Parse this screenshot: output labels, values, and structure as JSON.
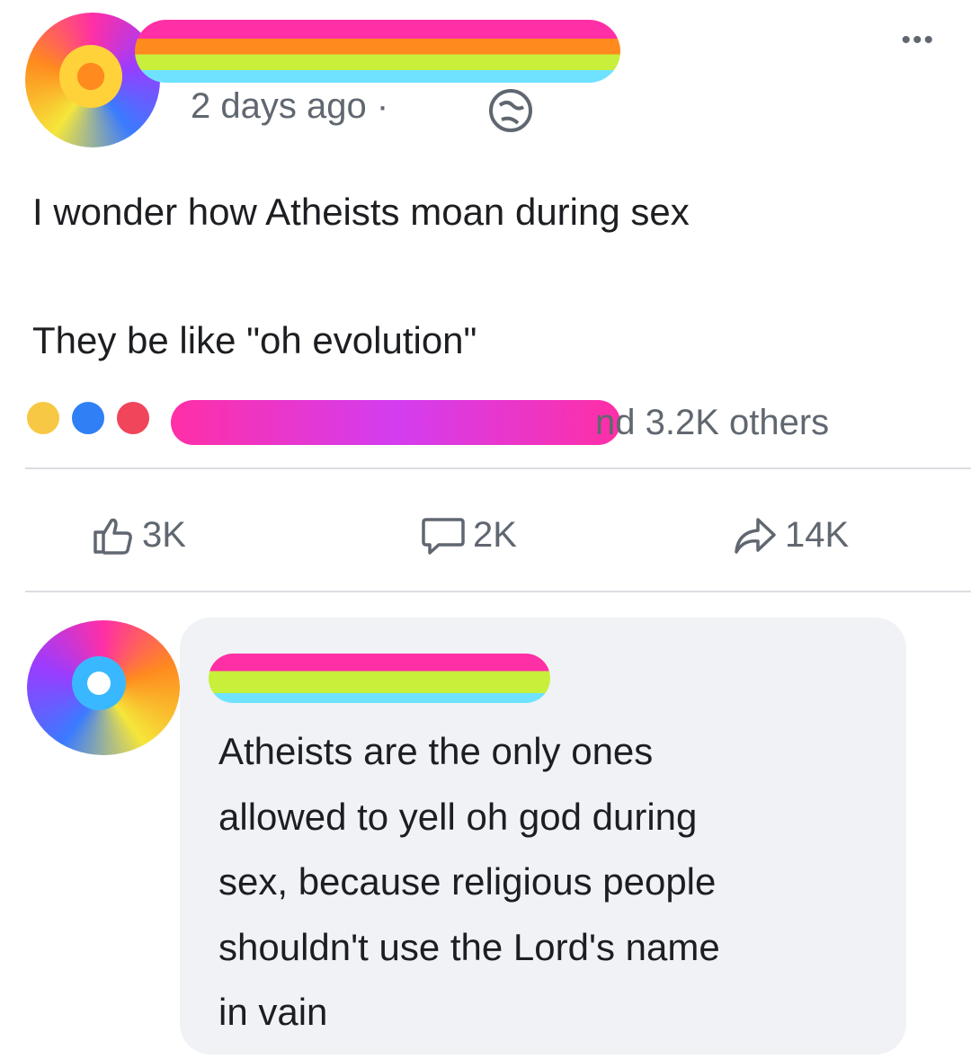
{
  "post": {
    "timestamp": "2 days ago ·",
    "menu_icon": "ellipsis-icon",
    "privacy_icon": "globe-icon",
    "text_line_1": "I wonder how Atheists moan during sex",
    "text_line_2": "They be like \"oh evolution\""
  },
  "reactions": {
    "icons": [
      "haha-icon",
      "like-icon",
      "love-icon"
    ],
    "summary": "nd 3.2K others"
  },
  "actions": {
    "like_count": "3K",
    "comment_count": "2K",
    "share_count": "14K"
  },
  "comment": {
    "text": "Atheists are the only ones\nallowed to yell oh god during\nsex, because religious people\nshouldn't use the Lord's name\nin vain"
  },
  "colors": {
    "secondary_text": "#606770",
    "primary_text": "#1c1e21",
    "like_blue": "#2f7ff5",
    "love_red": "#f0455a",
    "haha_yellow": "#f7c844",
    "comment_bubble": "#f0f2f5"
  }
}
